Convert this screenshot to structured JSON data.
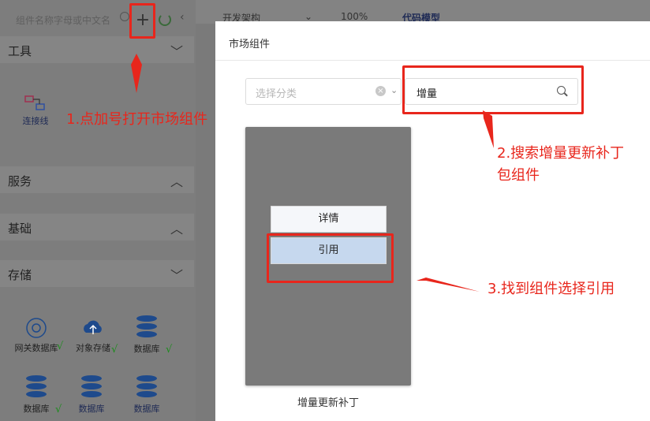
{
  "sidebar": {
    "search_placeholder": "组件名称字母或中文名",
    "sections": {
      "tools": "工具",
      "services": "服务",
      "basics": "基础",
      "storage": "存储"
    },
    "tool_items": [
      {
        "label": "连接线"
      }
    ],
    "storage_items": [
      {
        "label": "网关数据库"
      },
      {
        "label": "对象存储"
      },
      {
        "label": "数据库"
      },
      {
        "label": "数据库"
      },
      {
        "label": "数据库"
      },
      {
        "label": "数据库"
      }
    ]
  },
  "toolbar": {
    "architecture": "开发架构",
    "zoom": "100%",
    "code_mode": "代码模型"
  },
  "modal": {
    "title": "市场组件",
    "category_placeholder": "选择分类",
    "search_value": "增量",
    "card": {
      "name": "增量更新补丁",
      "detail_button": "详情",
      "use_button": "引用"
    }
  },
  "annotations": {
    "step1": "1.点加号打开市场组件",
    "step2": "2.搜索增量更新补丁\n包组件",
    "step3": "3.找到组件选择引用"
  },
  "colors": {
    "annotation": "#e8261c",
    "icon_blue": "#1e4a8c"
  }
}
